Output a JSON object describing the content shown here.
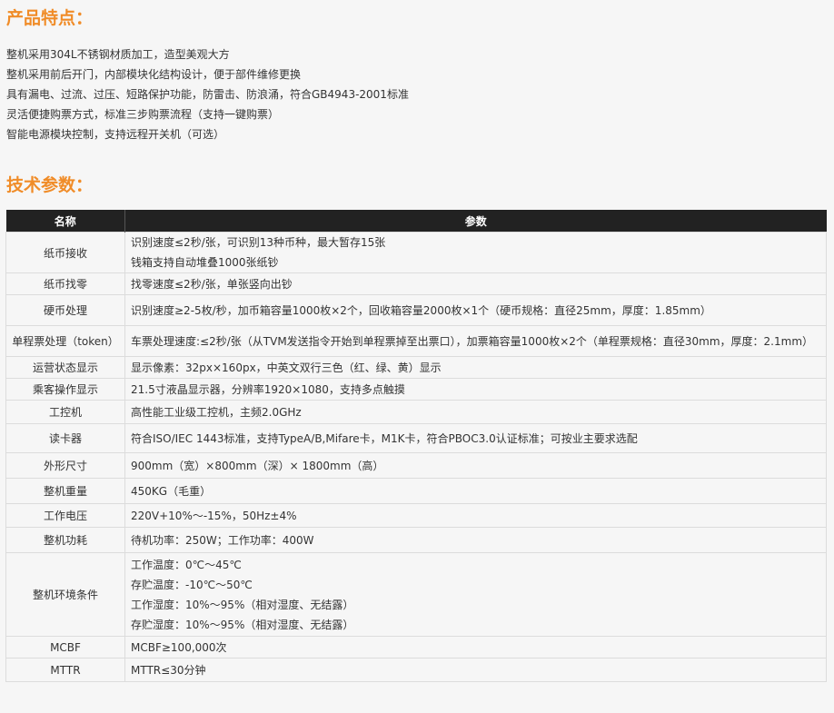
{
  "features_title": "产品特点：",
  "features": [
    "整机采用304L不锈钢材质加工，造型美观大方",
    "整机采用前后开门，内部模块化结构设计，便于部件维修更换",
    "具有漏电、过流、过压、短路保护功能，防雷击、防浪涌，符合GB4943-2001标准",
    "灵活便捷购票方式，标准三步购票流程（支持一键购票）",
    "智能电源模块控制，支持远程开关机（可选）"
  ],
  "specs_title": "技术参数：",
  "table": {
    "header": {
      "name": "名称",
      "value": "参数"
    },
    "rows": [
      {
        "name": "纸币接收",
        "lines": [
          "识别速度≤2秒/张，可识别13种币种，最大暂存15张",
          "钱箱支持自动堆叠1000张纸钞"
        ]
      },
      {
        "name": "纸币找零",
        "lines": [
          "找零速度≤2秒/张，单张竖向出钞"
        ]
      },
      {
        "name": "硬币处理",
        "lines": [
          "识别速度≥2-5枚/秒，加币箱容量1000枚×2个，回收箱容量2000枚×1个（硬币规格：直径25mm，厚度：1.85mm）"
        ]
      },
      {
        "name": "单程票处理（token）",
        "lines": [
          "车票处理速度:≤2秒/张（从TVM发送指令开始到单程票掉至出票口），加票箱容量1000枚×2个（单程票规格：直径30mm，厚度：2.1mm）"
        ]
      },
      {
        "name": "运营状态显示",
        "lines": [
          "显示像素：32px×160px，中英文双行三色（红、绿、黄）显示"
        ]
      },
      {
        "name": "乘客操作显示",
        "lines": [
          "21.5寸液晶显示器，分辨率1920×1080，支持多点触摸"
        ]
      },
      {
        "name": "工控机",
        "lines": [
          "高性能工业级工控机，主频2.0GHz"
        ]
      },
      {
        "name": "读卡器",
        "lines": [
          "符合ISO/IEC 1443标准，支持TypeA/B,Mifare卡，M1K卡，符合PBOC3.0认证标准；可按业主要求选配"
        ]
      },
      {
        "name": "外形尺寸",
        "lines": [
          "900mm（宽）×800mm（深）× 1800mm（高）"
        ]
      },
      {
        "name": "整机重量",
        "lines": [
          "450KG（毛重）"
        ]
      },
      {
        "name": "工作电压",
        "lines": [
          "220V+10%～-15%，50Hz±4%"
        ]
      },
      {
        "name": "整机功耗",
        "lines": [
          "待机功率：250W；工作功率：400W"
        ]
      },
      {
        "name": "整机环境条件",
        "lines": [
          "工作温度：0℃～45℃",
          "存贮温度：-10℃～50℃",
          "工作湿度：10%～95%（相对湿度、无结露）",
          "存贮湿度：10%～95%（相对湿度、无结露）"
        ]
      },
      {
        "name": "MCBF",
        "lines": [
          "MCBF≥100,000次"
        ]
      },
      {
        "name": "MTTR",
        "lines": [
          "MTTR≤30分钟"
        ]
      }
    ]
  },
  "colors": {
    "accent": "#f08c28",
    "header_bg": "#222222",
    "page_bg": "#f6f6f6"
  }
}
